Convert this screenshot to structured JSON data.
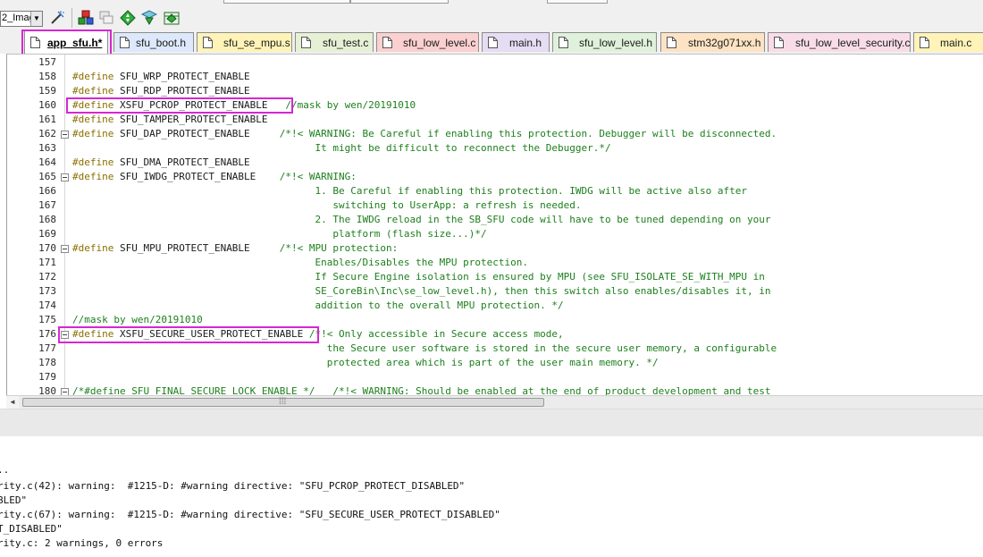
{
  "toolbar": {
    "target_combo": {
      "value": "2_Imag"
    },
    "buttons": [
      {
        "name": "options-for-target-icon",
        "glyph": "wand"
      },
      {
        "name": "manage-components-icon",
        "glyph": "blocks"
      },
      {
        "name": "select-packs-icon",
        "glyph": "stack"
      },
      {
        "name": "pack-installer-icon",
        "glyph": "diamond"
      },
      {
        "name": "configure-icon",
        "glyph": "arrow"
      },
      {
        "name": "batch-setup-icon",
        "glyph": "grid"
      }
    ]
  },
  "tabs": [
    {
      "label": "app_sfu.h*",
      "color": "#ffffff",
      "active": true
    },
    {
      "label": "sfu_boot.h",
      "color": "#dde9fb"
    },
    {
      "label": "sfu_se_mpu.s",
      "color": "#fff3b8"
    },
    {
      "label": "sfu_test.c",
      "color": "#e6f0d5"
    },
    {
      "label": "sfu_low_level.c",
      "color": "#fbd0d0"
    },
    {
      "label": "main.h",
      "color": "#e6dcf4"
    },
    {
      "label": "sfu_low_level.h",
      "color": "#dff1da"
    },
    {
      "label": "stm32g071xx.h",
      "color": "#fde3c3"
    },
    {
      "label": "sfu_low_level_security.c",
      "color": "#f8dde8"
    },
    {
      "label": "main.c",
      "color": "#fff3b8"
    }
  ],
  "code_lines": [
    {
      "n": "157",
      "fold": false,
      "kw": "",
      "text": "",
      "comment": ""
    },
    {
      "n": "158",
      "fold": false,
      "kw": "#define",
      "text": " SFU_WRP_PROTECT_ENABLE",
      "comment": ""
    },
    {
      "n": "159",
      "fold": false,
      "kw": "#define",
      "text": " SFU_RDP_PROTECT_ENABLE",
      "comment": ""
    },
    {
      "n": "160",
      "fold": false,
      "kw": "#define",
      "text": " XSFU_PCROP_PROTECT_ENABLE   ",
      "comment": "//mask by wen/20191010"
    },
    {
      "n": "161",
      "fold": false,
      "kw": "#define",
      "text": " SFU_TAMPER_PROTECT_ENABLE",
      "comment": ""
    },
    {
      "n": "162",
      "fold": true,
      "kw": "#define",
      "text": " SFU_DAP_PROTECT_ENABLE     ",
      "comment": "/*!< WARNING: Be Careful if enabling this protection. Debugger will be disconnected."
    },
    {
      "n": "163",
      "fold": false,
      "kw": "",
      "text": "",
      "comment": "                                         It might be difficult to reconnect the Debugger.*/"
    },
    {
      "n": "164",
      "fold": false,
      "kw": "#define",
      "text": " SFU_DMA_PROTECT_ENABLE",
      "comment": ""
    },
    {
      "n": "165",
      "fold": true,
      "kw": "#define",
      "text": " SFU_IWDG_PROTECT_ENABLE    ",
      "comment": "/*!< WARNING:"
    },
    {
      "n": "166",
      "fold": false,
      "kw": "",
      "text": "",
      "comment": "                                         1. Be Careful if enabling this protection. IWDG will be active also after"
    },
    {
      "n": "167",
      "fold": false,
      "kw": "",
      "text": "",
      "comment": "                                            switching to UserApp: a refresh is needed."
    },
    {
      "n": "168",
      "fold": false,
      "kw": "",
      "text": "",
      "comment": "                                         2. The IWDG reload in the SB_SFU code will have to be tuned depending on your"
    },
    {
      "n": "169",
      "fold": false,
      "kw": "",
      "text": "",
      "comment": "                                            platform (flash size...)*/"
    },
    {
      "n": "170",
      "fold": true,
      "kw": "#define",
      "text": " SFU_MPU_PROTECT_ENABLE     ",
      "comment": "/*!< MPU protection:"
    },
    {
      "n": "171",
      "fold": false,
      "kw": "",
      "text": "",
      "comment": "                                         Enables/Disables the MPU protection."
    },
    {
      "n": "172",
      "fold": false,
      "kw": "",
      "text": "",
      "comment": "                                         If Secure Engine isolation is ensured by MPU (see SFU_ISOLATE_SE_WITH_MPU in"
    },
    {
      "n": "173",
      "fold": false,
      "kw": "",
      "text": "",
      "comment": "                                         SE_CoreBin\\Inc\\se_low_level.h), then this switch also enables/disables it, in"
    },
    {
      "n": "174",
      "fold": false,
      "kw": "",
      "text": "",
      "comment": "                                         addition to the overall MPU protection. */"
    },
    {
      "n": "175",
      "fold": false,
      "kw": "",
      "text": "",
      "comment": "//mask by wen/20191010"
    },
    {
      "n": "176",
      "fold": true,
      "kw": "#define",
      "text": " XSFU_SECURE_USER_PROTECT_ENABLE ",
      "comment": "/*!< Only accessible in Secure access mode,"
    },
    {
      "n": "177",
      "fold": false,
      "kw": "",
      "text": "",
      "comment": "                                           the Secure user software is stored in the secure user memory, a configurable"
    },
    {
      "n": "178",
      "fold": false,
      "kw": "",
      "text": "",
      "comment": "                                           protected area which is part of the user main memory. */"
    },
    {
      "n": "179",
      "fold": false,
      "kw": "",
      "text": "",
      "comment": ""
    },
    {
      "n": "180",
      "fold": true,
      "kw": "",
      "text": "",
      "comment": "/*#define SFU_FINAL_SECURE_LOCK_ENABLE */   /*!< WARNING: Should be enabled at the end of product development and test"
    }
  ],
  "build_output": [
    "..",
    "rity.c(42): warning:  #1215-D: #warning directive: \"SFU_PCROP_PROTECT_DISABLED\"",
    "BLED\"",
    "rity.c(67): warning:  #1215-D: #warning directive: \"SFU_SECURE_USER_PROTECT_DISABLED\"",
    "T_DISABLED\"",
    "rity.c: 2 warnings, 0 errors"
  ]
}
